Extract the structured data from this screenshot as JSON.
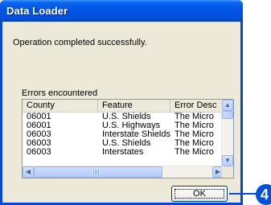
{
  "window": {
    "title": "Data Loader"
  },
  "message": "Operation completed successfully.",
  "errors_label": "Errors encountered",
  "table": {
    "columns": [
      "County",
      "Feature",
      "Error Desc"
    ],
    "rows": [
      [
        "06001",
        "U.S. Shields",
        "The Micro"
      ],
      [
        "06001",
        "U.S. Highways",
        "The Micro"
      ],
      [
        "06003",
        "Interstate Shields",
        "The Micro"
      ],
      [
        "06003",
        "U.S. Shields",
        "The Micro"
      ],
      [
        "06003",
        "Interstates",
        "The Micro"
      ]
    ]
  },
  "scrollbars": {
    "up_arrow": "▲",
    "down_arrow": "▼",
    "left_arrow": "◀",
    "right_arrow": "▶"
  },
  "ok_label": "OK",
  "callout": {
    "number": "4",
    "color": "#0050db"
  },
  "colors": {
    "titlebar": "#0055e5",
    "dialog_bg": "#ece9d8",
    "list_border": "#7f9db9"
  }
}
